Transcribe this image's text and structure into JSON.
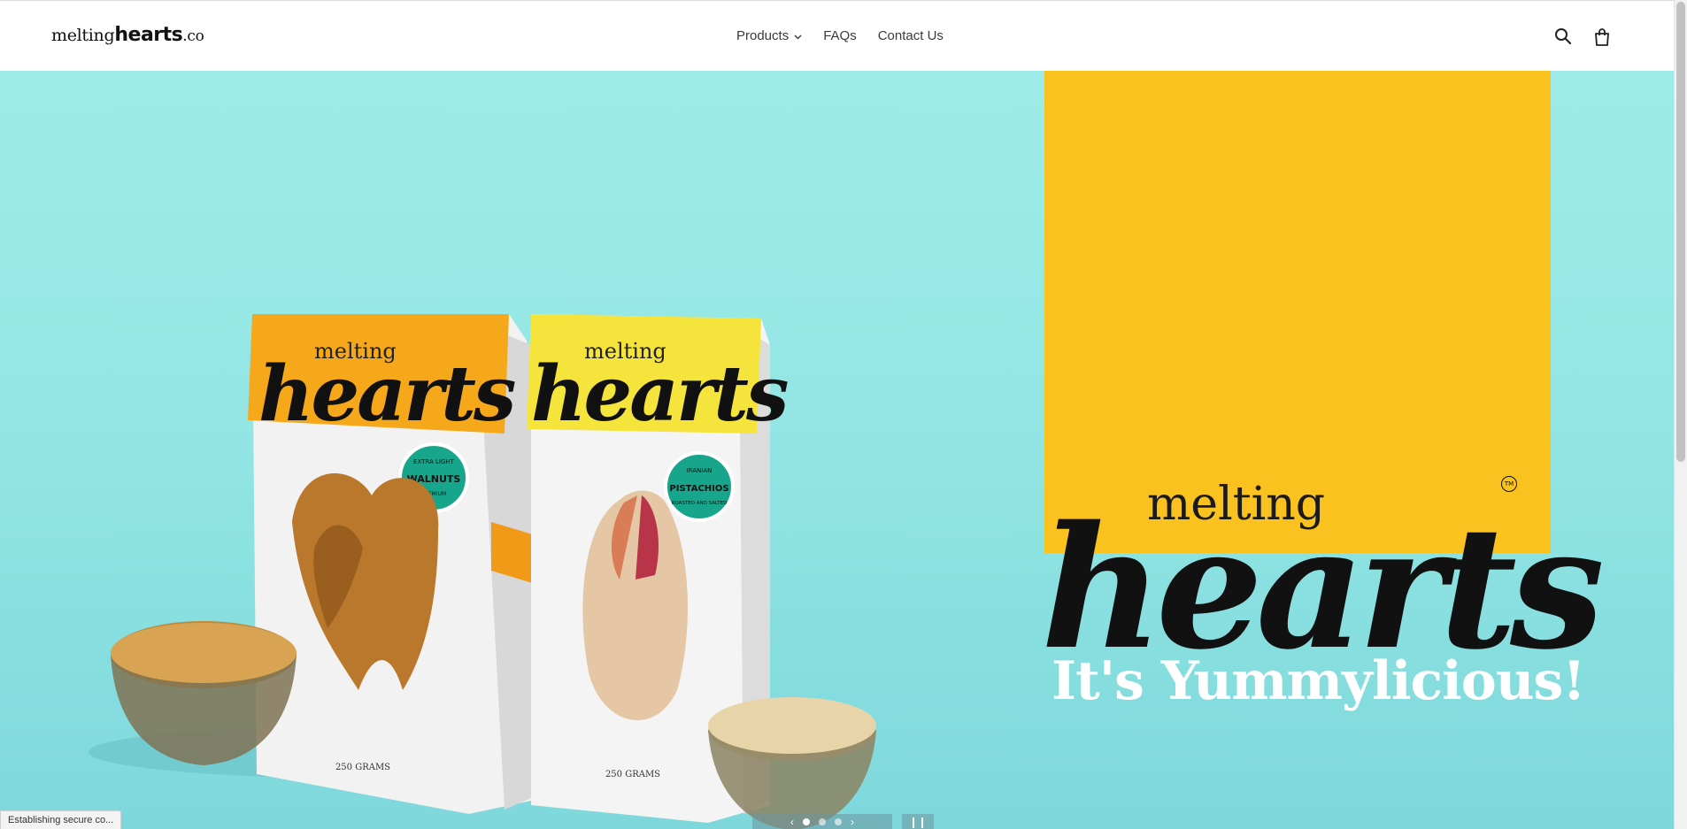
{
  "header": {
    "logo_regular": "melting",
    "logo_bold": "hearts",
    "logo_suffix": ".co",
    "nav": [
      {
        "label": "Products",
        "has_dropdown": true
      },
      {
        "label": "FAQs"
      },
      {
        "label": "Contact Us"
      }
    ],
    "icons": [
      "search-icon",
      "cart-icon"
    ]
  },
  "hero": {
    "brand_small": "melting",
    "brand_big": "hearts",
    "trademark": "TM",
    "tagline": "It's Yummylicious!",
    "packs": [
      {
        "brand_small": "melting",
        "brand_big": "hearts",
        "badge_top": "EXTRA LIGHT",
        "badge_mid": "WALNUTS",
        "badge_bottom": "PREMIUM",
        "weight": "250 GRAMS",
        "color": "#f7a81a"
      },
      {
        "brand_small": "melting",
        "brand_big": "hearts",
        "badge_top": "IRANIAN",
        "badge_mid": "PISTACHIOS",
        "badge_bottom": "ROASTED AND SALTED",
        "weight": "250 GRAMS",
        "color": "#f5e03a"
      }
    ],
    "colors": {
      "background": "#9eece9",
      "banner": "#f9c21f",
      "tagline": "#ffffff"
    }
  },
  "slider": {
    "slides_count": 3,
    "active_index": 0,
    "prev_label": "‹",
    "next_label": "›",
    "pause_label": "❙❙"
  },
  "browser_status": {
    "text": "Establishing secure co..."
  }
}
